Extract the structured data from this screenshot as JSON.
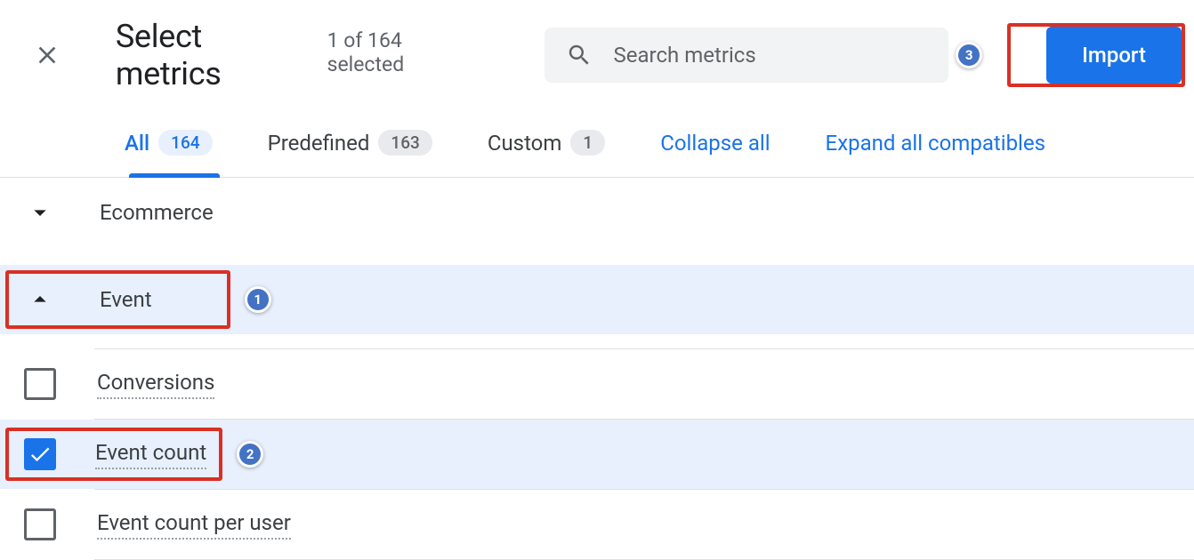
{
  "header": {
    "title": "Select metrics",
    "subtitle": "1 of 164 selected",
    "search_placeholder": "Search metrics",
    "import_label": "Import"
  },
  "tabs": {
    "all": {
      "label": "All",
      "count": "164"
    },
    "predefined": {
      "label": "Predefined",
      "count": "163"
    },
    "custom": {
      "label": "Custom",
      "count": "1"
    },
    "collapse_all": "Collapse all",
    "expand_all": "Expand all compatibles"
  },
  "categories": {
    "ecommerce": {
      "label": "Ecommerce"
    },
    "event": {
      "label": "Event"
    }
  },
  "metrics": {
    "conversions": {
      "label": "Conversions"
    },
    "event_count": {
      "label": "Event count"
    },
    "event_count_per_user": {
      "label": "Event count per user"
    }
  },
  "steps": {
    "one": "1",
    "two": "2",
    "three": "3"
  }
}
